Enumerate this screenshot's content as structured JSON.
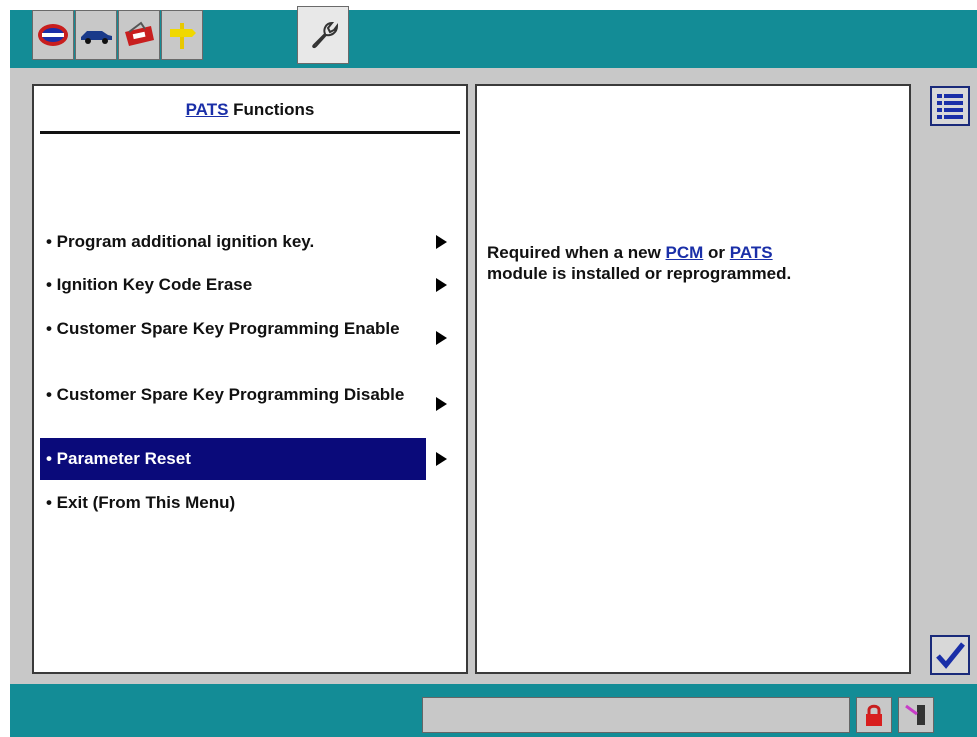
{
  "tabs": [
    {
      "icon": "ids-logo-icon"
    },
    {
      "icon": "vehicle-icon"
    },
    {
      "icon": "toolbox-icon"
    },
    {
      "icon": "signpost-icon"
    },
    {
      "icon": "wrench-icon",
      "active": true
    }
  ],
  "left_panel": {
    "title_link": "PATS",
    "title_rest": " Functions",
    "items": [
      {
        "label": "• Program additional ignition key."
      },
      {
        "label": "• Ignition Key Code Erase"
      },
      {
        "label": "• Customer Spare Key Programming Enable"
      },
      {
        "label": "• Customer Spare Key Programming Disable"
      },
      {
        "label": "• Parameter Reset",
        "selected": true
      },
      {
        "label": "• Exit (From This Menu)"
      }
    ]
  },
  "right_panel": {
    "desc_1": "Required when a new ",
    "link_pcm": "PCM",
    "desc_2": " or ",
    "link_pats": "PATS",
    "desc_3": "module is installed or reprogrammed."
  },
  "side_buttons": {
    "list": "list-icon",
    "confirm": "checkmark-icon"
  },
  "status": {
    "field_text": "",
    "lock": "lock-icon",
    "tool": "probe-icon"
  },
  "colors": {
    "teal": "#138c96",
    "selection": "#0a0a7a",
    "link": "#1a2fa8"
  }
}
